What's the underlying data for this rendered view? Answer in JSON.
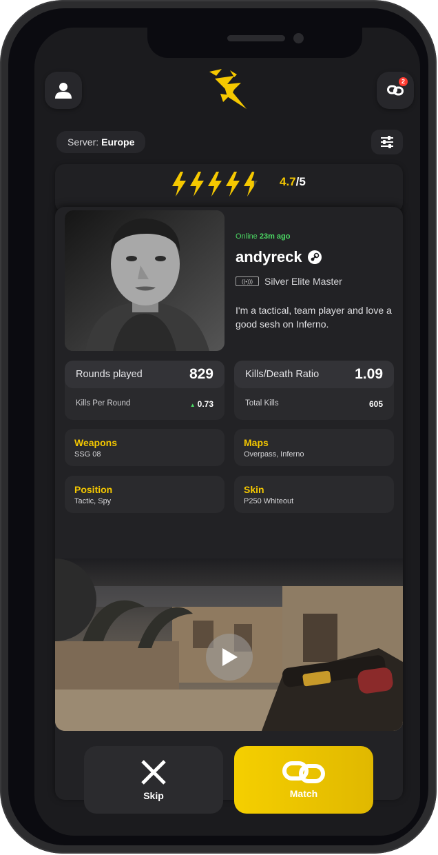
{
  "header": {
    "profile_icon": "user-icon",
    "logo": "wasp-logo",
    "matches_icon": "link-icon",
    "matches_badge": "2"
  },
  "filters": {
    "server_label": "Server:",
    "server_value": "Europe",
    "filter_icon": "sliders-icon"
  },
  "rating": {
    "value": "4.7",
    "max": "/5",
    "level": 4.7,
    "icon": "lightning-icon"
  },
  "profile": {
    "online_label": "Online",
    "online_time": "23m ago",
    "username": "andyreck",
    "platform_icon": "steam-icon",
    "rank": "Silver Elite Master",
    "bio": "I'm a tactical, team player and love a good sesh on Inferno."
  },
  "stats": [
    {
      "label": "Rounds played",
      "value": "829",
      "sub_label": "Kills Per Round",
      "sub_value": "0.73",
      "trend": "up"
    },
    {
      "label": "Kills/Death Ratio",
      "value": "1.09",
      "sub_label": "Total Kills",
      "sub_value": "605"
    }
  ],
  "details": [
    {
      "title": "Weapons",
      "value": "SSG 08"
    },
    {
      "title": "Maps",
      "value": "Overpass, Inferno"
    },
    {
      "title": "Position",
      "value": "Tactic, Spy"
    },
    {
      "title": "Skin",
      "value": "P250 Whiteout"
    }
  ],
  "video": {
    "play_icon": "play-icon"
  },
  "actions": {
    "skip_label": "Skip",
    "match_label": "Match"
  },
  "colors": {
    "accent": "#f5c800",
    "online": "#4cd964",
    "background": "#1b1b1e"
  }
}
